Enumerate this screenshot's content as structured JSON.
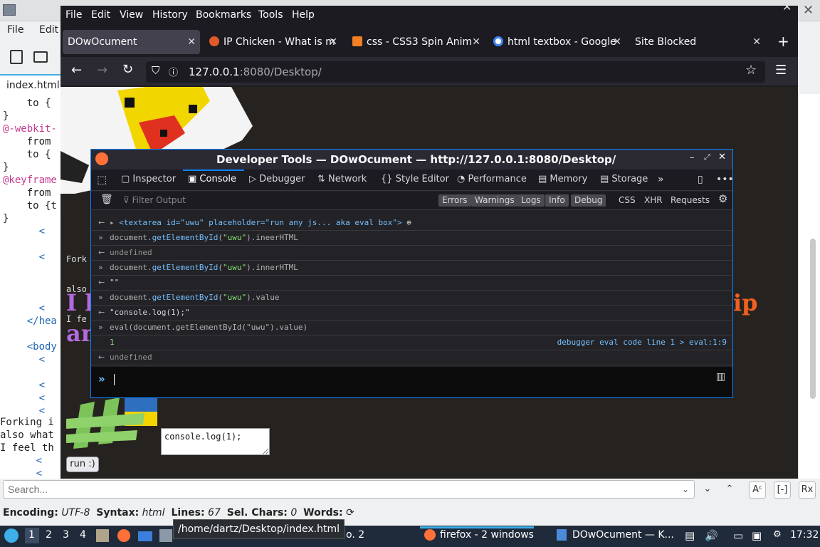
{
  "kate": {
    "menu": [
      "File",
      "Edit"
    ],
    "tab_label": "index.html",
    "code_lines": [
      {
        "text": "    to {",
        "cls": ""
      },
      {
        "text": "}",
        "cls": ""
      },
      {
        "text": "@-webkit-",
        "cls": "kw"
      },
      {
        "text": "    from",
        "cls": ""
      },
      {
        "text": "    to {",
        "cls": ""
      },
      {
        "text": "}",
        "cls": ""
      },
      {
        "text": "@keyframe",
        "cls": "kw"
      },
      {
        "text": "    from",
        "cls": ""
      },
      {
        "text": "    to {t",
        "cls": ""
      },
      {
        "text": "}",
        "cls": ""
      },
      {
        "text": "      <",
        "cls": "tg"
      },
      {
        "text": "",
        "cls": ""
      },
      {
        "text": "      <",
        "cls": "tg"
      },
      {
        "text": "",
        "cls": ""
      },
      {
        "text": "",
        "cls": ""
      },
      {
        "text": "",
        "cls": ""
      },
      {
        "text": "      <",
        "cls": "tg"
      },
      {
        "text": "    </hea",
        "cls": "tg"
      },
      {
        "text": "",
        "cls": ""
      },
      {
        "text": "    <body",
        "cls": "tg"
      },
      {
        "text": "      <",
        "cls": "tg"
      },
      {
        "text": "",
        "cls": ""
      },
      {
        "text": "      <",
        "cls": "tg"
      },
      {
        "text": "      <",
        "cls": "tg"
      },
      {
        "text": "      <",
        "cls": "tg"
      }
    ],
    "lower_lines": [
      "Forking i",
      "also what",
      "I feel th",
      "      <",
      "      <"
    ],
    "search_placeholder": "Search...",
    "status": {
      "encoding_label": "Encoding:",
      "encoding": "UTF-8",
      "syntax_label": "Syntax:",
      "syntax": "html",
      "lines_label": "Lines:",
      "lines": "67",
      "sel_label": "Sel. Chars:",
      "sel": "0",
      "words_label": "Words:"
    }
  },
  "firefox": {
    "menu": [
      "File",
      "Edit",
      "View",
      "History",
      "Bookmarks",
      "Tools",
      "Help"
    ],
    "tabs": [
      {
        "label": "DOwOcument",
        "active": true,
        "color": ""
      },
      {
        "label": "IP Chicken - What is m",
        "active": false,
        "color": "#e05a2a"
      },
      {
        "label": "css - CSS3 Spin Anim",
        "active": false,
        "color": "#f48024"
      },
      {
        "label": "html textbox - Google",
        "active": false,
        "color": "#4285f4"
      },
      {
        "label": "Site Blocked",
        "active": false,
        "color": ""
      }
    ],
    "url_host": "127.0.0.1",
    "url_rest": ":8080/Desktop/",
    "page": {
      "big_left": "I l",
      "big_left2": "an",
      "big_right": "ip",
      "small_lines": [
        "Fork",
        "also",
        "I fe"
      ],
      "textarea_value": "console.log(1);",
      "run_button": "run :)"
    }
  },
  "devtools": {
    "title": "Developer Tools — DOwOcument — http://127.0.0.1:8080/Desktop/",
    "tabs": [
      "Inspector",
      "Console",
      "Debugger",
      "Network",
      "Style Editor",
      "Performance",
      "Memory",
      "Storage"
    ],
    "filter_placeholder": "Filter Output",
    "filter_buttons": [
      "Errors",
      "Warnings",
      "Logs",
      "Info",
      "Debug"
    ],
    "filter_extra": [
      "CSS",
      "XHR",
      "Requests"
    ],
    "console": {
      "textarea_node": "<textarea id=\"uwu\" placeholder=\"run any js... aka eval box\">",
      "in1_a": "document.",
      "in1_b": "getElementById",
      "in1_c": "(",
      "in1_d": "\"uwu\"",
      "in1_e": ").ineerHTML",
      "out1": "undefined",
      "in2_e": ").innerHTML",
      "out2": "\"\"",
      "in3_e": ").value",
      "out3": "\"console.log(1);\"",
      "in4": "eval(document.getElementById(\"uwu\").value)",
      "log": "1",
      "log_src": "debugger eval code line 1 > eval:1:9",
      "out4": "undefined"
    }
  },
  "taskbar": {
    "workspaces": [
      "1",
      "2",
      "3",
      "4"
    ],
    "tooltip": "/home/dartz/Desktop/index.html",
    "partial": "o. 2",
    "firefox_item": "firefox - 2 windows",
    "kate_item": "DOwOcument — K...",
    "clock": "17:32"
  }
}
